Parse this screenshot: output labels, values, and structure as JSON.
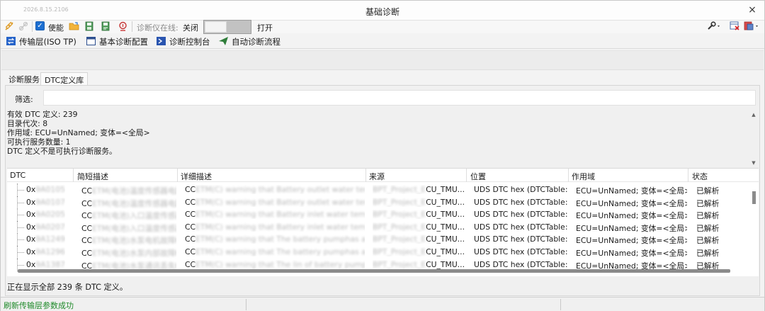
{
  "window": {
    "stamp": "2026.8.15.2106",
    "title": "基础诊断",
    "close_glyph": "×"
  },
  "toolbar": {
    "enable_label": "使能",
    "online_label": "诊断仪在线:",
    "online_state": "关闭",
    "open_label": "打开",
    "icons": [
      "connect-icon",
      "disconnect-icon",
      "open-folder-icon",
      "save-icon",
      "save-as-icon",
      "read-icon",
      "wrench-icon",
      "clear-icon",
      "layout-icon"
    ]
  },
  "feature_tabs": [
    {
      "label": "传输层(ISO TP)",
      "icon": "transport-icon"
    },
    {
      "label": "基本诊断配置",
      "icon": "window-icon"
    },
    {
      "label": "诊断控制台",
      "icon": "console-icon"
    },
    {
      "label": "自动诊断流程",
      "icon": "send-icon"
    }
  ],
  "inner_tabs": [
    {
      "label": "诊断服务"
    },
    {
      "label": "DTC定义库"
    }
  ],
  "filter": {
    "label": "筛选:",
    "value": ""
  },
  "info": {
    "line1": "有效 DTC 定义: 239",
    "line2": "目录代次: 8",
    "line3": "作用域: ECU=UnNamed; 变体=<全局>",
    "line4": "可执行服务数量: 1",
    "line5": "DTC 定义不是可执行诊断服务。"
  },
  "table": {
    "columns": [
      "DTC",
      "简短描述",
      "详细描述",
      "来源",
      "位置",
      "作用域",
      "状态"
    ],
    "rows": [
      {
        "dtc": "0x",
        "dtc_hidden": "9A0105",
        "short": "CC",
        "short_hidden": "ETM(电池)温度传感器电路高压K...",
        "detail": "CC",
        "detail_hidden": "ETM(C) warning that Battery outlet water tempe...",
        "source_hidden": "BPT_Project_E",
        "source": "CU_TMU....",
        "location": "UDS DTC hex (DTCTable:...",
        "scope": "ECU=UnNamed; 变体=<全局>",
        "status": "已解析"
      },
      {
        "dtc": "0x",
        "dtc_hidden": "9A0107",
        "short": "CC",
        "short_hidden": "ETM(电池)温度传感器电路低压K...",
        "detail": "CC",
        "detail_hidden": "ETM(C) warning that Battery outlet water tempe...",
        "source_hidden": "BPT_Project_E",
        "source": "CU_TMU....",
        "location": "UDS DTC hex (DTCTable:...",
        "scope": "ECU=UnNamed; 变体=<全局>",
        "status": "已解析"
      },
      {
        "dtc": "0x",
        "dtc_hidden": "9A0205",
        "short": "CC",
        "short_hidden": "ETM(电池)入口温度传感器高压K...",
        "detail": "CC",
        "detail_hidden": "ETM(C) warning that Battery inlet water tempera...",
        "source_hidden": "BPT_Project_E",
        "source": "CU_TMU....",
        "location": "UDS DTC hex (DTCTable:...",
        "scope": "ECU=UnNamed; 变体=<全局>",
        "status": "已解析"
      },
      {
        "dtc": "0x",
        "dtc_hidden": "9A0207",
        "short": "CC",
        "short_hidden": "ETM(电池)入口温度传感器低压K...",
        "detail": "CC",
        "detail_hidden": "ETM(C) warning that Battery inlet water tempera...",
        "source_hidden": "BPT_Project_E",
        "source": "CU_TMU....",
        "location": "UDS DTC hex (DTCTable:...",
        "scope": "ECU=UnNamed; 变体=<全局>",
        "status": "已解析"
      },
      {
        "dtc": "0x",
        "dtc_hidden": "9A1249",
        "short": "CC",
        "short_hidden": "ETM(电池)水泵电机故障K...",
        "detail": "CC",
        "detail_hidden": "ETM(C) warning that The battery pumphas a ma...",
        "source_hidden": "BPT_Project_E",
        "source": "CU_TMU....",
        "location": "UDS DTC hex (DTCTable:...",
        "scope": "ECU=UnNamed; 变体=<全局>",
        "status": "已解析"
      },
      {
        "dtc": "0x",
        "dtc_hidden": "9A1296",
        "short": "CC",
        "short_hidden": "ETM(电池)水泵内部故障K...",
        "detail": "CC",
        "detail_hidden": "ETM(C) warning that The battery pumphas a ma...",
        "source_hidden": "BPT_Project_E",
        "source": "CU_TMU....",
        "location": "UDS DTC hex (DTCTable:...",
        "scope": "ECU=UnNamed; 变体=<全局>",
        "status": "已解析"
      },
      {
        "dtc": "0x",
        "dtc_hidden": "9A1387",
        "short": "CC",
        "short_hidden": "ETM(电池)水泵通讯丢失K...",
        "detail": "CC",
        "detail_hidden": "ETM(C) warning that The lin of battery pumpha...",
        "source_hidden": "BPT_Project_E",
        "source": "CU_TMU....",
        "location": "UDS DTC hex (DTCTable:...",
        "scope": "ECU=UnNamed; 变体=<全局>",
        "status": "已解析"
      }
    ]
  },
  "status_line": "正在显示全部 239 条 DTC 定义。",
  "statusbar": {
    "message": "刷新传输层参数成功",
    "message_color": "#1f8a2a"
  }
}
